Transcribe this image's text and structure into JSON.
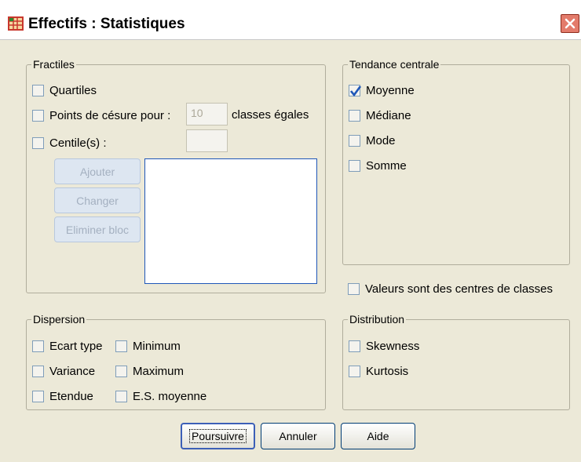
{
  "window": {
    "title": "Effectifs : Statistiques",
    "close_glyph": "✕"
  },
  "fractiles": {
    "legend": "Fractiles",
    "quartiles": "Quartiles",
    "cutpoints": "Points de césure pour :",
    "cutpoints_value": "10",
    "cutpoints_suffix": "classes égales",
    "percentiles": "Centile(s) :",
    "percentile_value": "",
    "add": "Ajouter",
    "change": "Changer",
    "remove": "Eliminer bloc"
  },
  "central": {
    "legend": "Tendance centrale",
    "mean": "Moyenne",
    "median": "Médiane",
    "mode": "Mode",
    "sum": "Somme"
  },
  "grouped": "Valeurs sont des centres de classes",
  "dispersion": {
    "legend": "Dispersion",
    "std": "Ecart type",
    "minimum": "Minimum",
    "variance": "Variance",
    "maximum": "Maximum",
    "range": "Etendue",
    "se_mean": "E.S. moyenne"
  },
  "distribution": {
    "legend": "Distribution",
    "skewness": "Skewness",
    "kurtosis": "Kurtosis"
  },
  "buttons": {
    "continue": "Poursuivre",
    "cancel": "Annuler",
    "help": "Aide"
  },
  "state": {
    "mean_checked": true
  },
  "colors": {
    "accent": "#1f57b8",
    "check": "#21a121",
    "close": "#e37b6b"
  }
}
